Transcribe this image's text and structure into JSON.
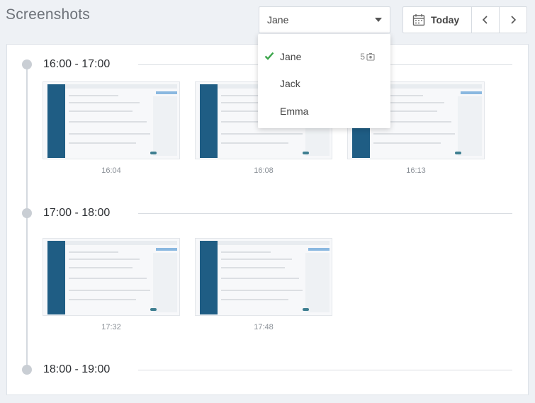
{
  "page": {
    "title": "Screenshots"
  },
  "user_select": {
    "selected": "Jane",
    "options": [
      {
        "label": "Jane",
        "selected": true,
        "count": "5"
      },
      {
        "label": "Jack",
        "selected": false
      },
      {
        "label": "Emma",
        "selected": false
      }
    ]
  },
  "date_nav": {
    "today_label": "Today",
    "prev_icon": "chevron-left",
    "next_icon": "chevron-right"
  },
  "timeline": [
    {
      "range": "16:00 - 17:00",
      "shots": [
        "16:04",
        "16:08",
        "16:13"
      ]
    },
    {
      "range": "17:00 - 18:00",
      "shots": [
        "17:32",
        "17:48"
      ]
    },
    {
      "range": "18:00 - 19:00",
      "shots": []
    }
  ],
  "colors": {
    "accent_check": "#3aa54a",
    "thumb_sidebar": "#1f5d84"
  }
}
